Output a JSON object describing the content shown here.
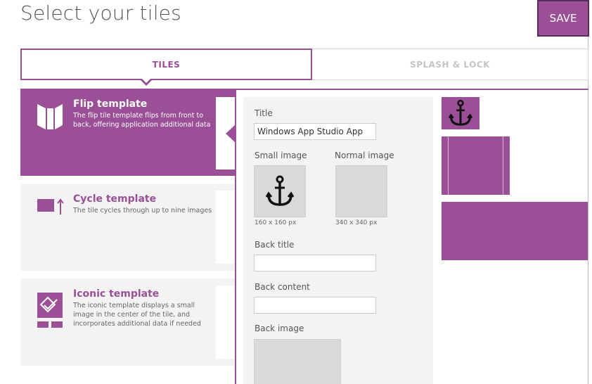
{
  "header": {
    "title": "Select your tiles",
    "save_label": "SAVE"
  },
  "tabs": [
    {
      "label": "TILES",
      "active": true
    },
    {
      "label": "SPLASH & LOCK",
      "active": false
    }
  ],
  "templates": [
    {
      "name": "Flip template",
      "description": "The flip tile template flips from front to back, offering application additional data",
      "icon": "flip-tile-icon",
      "selected": true
    },
    {
      "name": "Cycle template",
      "description": "The tile cycles through up to nine images",
      "icon": "cycle-tile-icon",
      "selected": false
    },
    {
      "name": "Iconic template",
      "description": "The iconic template displays a small image in the center of the tile, and incorporates additional data if needed",
      "icon": "iconic-tile-icon",
      "selected": false
    }
  ],
  "editor": {
    "title_label": "Title",
    "title_value": "Windows App Studio App",
    "small_image_label": "Small image",
    "small_image_size": "160 x 160 px",
    "small_image_icon": "anchor-icon",
    "normal_image_label": "Normal image",
    "normal_image_size": "340 x 340 px",
    "back_title_label": "Back title",
    "back_title_value": "",
    "back_content_label": "Back content",
    "back_content_value": "",
    "back_image_label": "Back image"
  },
  "colors": {
    "accent": "#9b4f96",
    "panel_bg": "#f3f3f3",
    "placeholder_bg": "#d9d9d9"
  }
}
